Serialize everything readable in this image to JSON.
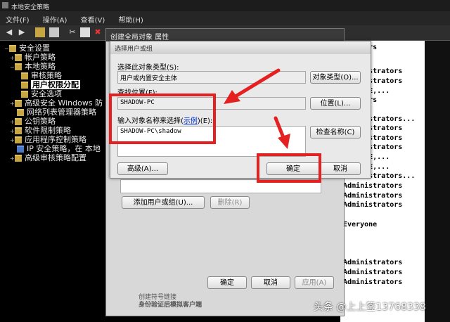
{
  "window": {
    "title": "本地安全策略"
  },
  "menu": [
    "文件(F)",
    "操作(A)",
    "查看(V)",
    "帮助(H)"
  ],
  "toolbar": {
    "icons": [
      "back-icon",
      "forward-icon",
      "up-folder-icon",
      "properties-icon",
      "cut-icon",
      "copy-icon",
      "delete-icon",
      "export-icon",
      "help-icon"
    ]
  },
  "tree": {
    "items": [
      {
        "label": "安全设置",
        "expand": "−"
      },
      {
        "label": "帐户策略",
        "expand": "+"
      },
      {
        "label": "本地策略",
        "expand": "−"
      },
      {
        "label": "审核策略",
        "expand": ""
      },
      {
        "label": "用户权限分配",
        "expand": "",
        "selected": true
      },
      {
        "label": "安全选项",
        "expand": ""
      },
      {
        "label": "高级安全 Windows 防",
        "expand": "+"
      },
      {
        "label": "网络列表管理器策略",
        "expand": ""
      },
      {
        "label": "公钥策略",
        "expand": "+"
      },
      {
        "label": "软件限制策略",
        "expand": "+"
      },
      {
        "label": "应用程序控制策略",
        "expand": "+"
      },
      {
        "label": "IP 安全策略，在 本地",
        "expand": ""
      },
      {
        "label": "高级审核策略配置",
        "expand": "+"
      }
    ]
  },
  "list": {
    "entries": [
      "strators",
      "Administrators",
      "Administrators",
      "SERVICE,...",
      "strators",
      "Administrators...",
      "Administrators",
      "Administrators",
      "Administrators",
      "SERVICE,...",
      "SERVICE,...",
      "Administrators...",
      "Administrators",
      "Administrators",
      "Administrators",
      "Everyone",
      "Administrators",
      "Administrators",
      "Administrators"
    ]
  },
  "properties_dialog": {
    "title": "创建全局对象 属性",
    "add_button": "添加用户或组(U)...",
    "remove_button": "删除(R)",
    "ok": "确定",
    "cancel": "取消",
    "apply": "应用(A)",
    "list_item_1": "创建符号链接",
    "list_item_2": "身份验证后模拟客户端"
  },
  "select_dialog": {
    "title": "选择用户或组",
    "object_type_label": "选择此对象类型(S):",
    "object_type_value": "用户或内置安全主体",
    "object_type_button": "对象类型(O)...",
    "location_label": "查找位置(F):",
    "location_value": "SHADOW-PC",
    "location_button": "位置(L)...",
    "enter_label_prefix": "输入对象名称来选择(",
    "enter_label_link": "示例",
    "enter_label_suffix": ")(E):",
    "enter_value": "SHADOW-PC\\shadow",
    "check_names_button": "检查名称(C)",
    "advanced_button": "高级(A)...",
    "ok_button": "确定",
    "cancel_button": "取消"
  },
  "watermark": "头条 @上上签13768338"
}
